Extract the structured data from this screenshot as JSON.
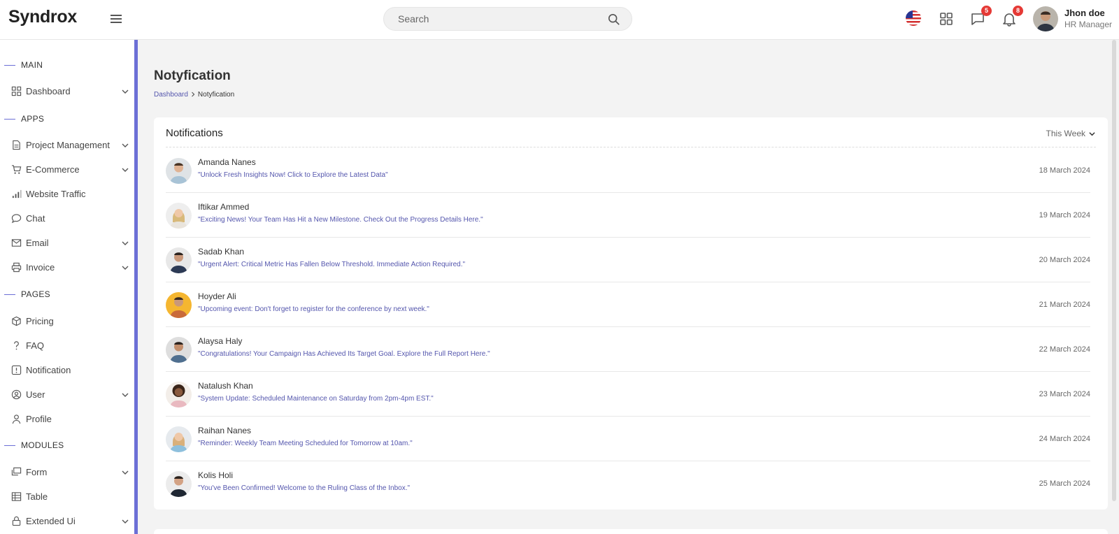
{
  "header": {
    "brand": "Syndrox",
    "search_placeholder": "Search",
    "messages_badge": "5",
    "notifications_badge": "8",
    "user": {
      "name": "Jhon doe",
      "role": "HR Manager"
    }
  },
  "sidebar": {
    "sections": [
      {
        "label": "MAIN"
      },
      {
        "label": "APPS"
      },
      {
        "label": "PAGES"
      },
      {
        "label": "MODULES"
      }
    ],
    "items": [
      {
        "label": "Dashboard",
        "icon": "grid-icon",
        "has_submenu": true
      },
      {
        "label": "Project Management",
        "icon": "file-icon",
        "has_submenu": true
      },
      {
        "label": "E-Commerce",
        "icon": "cart-icon",
        "has_submenu": true
      },
      {
        "label": "Website Traffic",
        "icon": "signal-icon",
        "has_submenu": false
      },
      {
        "label": "Chat",
        "icon": "chat-icon",
        "has_submenu": false
      },
      {
        "label": "Email",
        "icon": "mail-icon",
        "has_submenu": true
      },
      {
        "label": "Invoice",
        "icon": "printer-icon",
        "has_submenu": true
      },
      {
        "label": "Pricing",
        "icon": "box-icon",
        "has_submenu": false
      },
      {
        "label": "FAQ",
        "icon": "question-icon",
        "has_submenu": false
      },
      {
        "label": "Notification",
        "icon": "alert-icon",
        "has_submenu": false
      },
      {
        "label": "User",
        "icon": "user-circle-icon",
        "has_submenu": true
      },
      {
        "label": "Profile",
        "icon": "person-icon",
        "has_submenu": false
      },
      {
        "label": "Form",
        "icon": "form-icon",
        "has_submenu": true
      },
      {
        "label": "Table",
        "icon": "table-icon",
        "has_submenu": false
      },
      {
        "label": "Extended Ui",
        "icon": "lock-icon",
        "has_submenu": true
      }
    ]
  },
  "page": {
    "title": "Notyfication",
    "breadcrumb": {
      "home": "Dashboard",
      "current": "Notyfication"
    }
  },
  "notifications": {
    "title": "Notifications",
    "filter": "This Week",
    "items": [
      {
        "name": "Amanda Nanes",
        "message": "\"Unlock Fresh Insights Now! Click to Explore the Latest Data\"",
        "date": "18 March 2024"
      },
      {
        "name": "Iftikar Ammed",
        "message": "\"Exciting News! Your Team Has Hit a New Milestone. Check Out the Progress Details Here.\"",
        "date": "19 March 2024"
      },
      {
        "name": "Sadab Khan",
        "message": "\"Urgent Alert: Critical Metric Has Fallen Below Threshold. Immediate Action Required.\"",
        "date": "20 March 2024"
      },
      {
        "name": "Hoyder Ali",
        "message": "\"Upcoming event: Don't forget to register for the conference by next week.\"",
        "date": "21 March 2024"
      },
      {
        "name": "Alaysa Haly",
        "message": "\"Congratulations! Your Campaign Has Achieved Its Target Goal. Explore the Full Report Here.\"",
        "date": "22 March 2024"
      },
      {
        "name": "Natalush Khan",
        "message": "\"System Update: Scheduled Maintenance on Saturday from 2pm-4pm EST.\"",
        "date": "23 March 2024"
      },
      {
        "name": "Raihan Nanes",
        "message": "\"Reminder: Weekly Team Meeting Scheduled for Tomorrow at 10am.\"",
        "date": "24 March 2024"
      },
      {
        "name": "Kolis Holi",
        "message": "\"You've Been Confirmed! Welcome to the Ruling Class of the Inbox.\"",
        "date": "25 March 2024"
      }
    ]
  },
  "colors": {
    "accent": "#6c6fd6",
    "link": "#5456ad",
    "badge": "#e53935"
  }
}
